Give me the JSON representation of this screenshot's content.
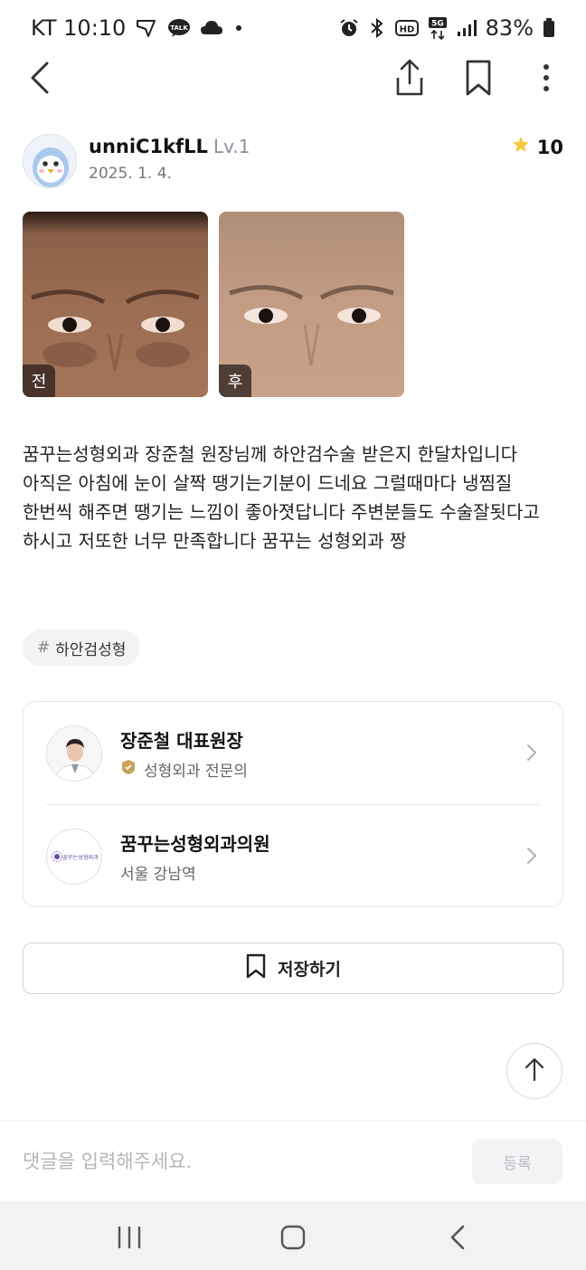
{
  "status_bar": {
    "carrier_time": "KT 10:10",
    "battery": "83%",
    "icons": [
      "navigation-icon",
      "talk-icon",
      "cloud-icon",
      "dot-icon",
      "alarm-icon",
      "bluetooth-icon",
      "hd-icon",
      "5g-icon",
      "signal-icon",
      "battery-icon"
    ],
    "talk_badge": "TALK",
    "hd_label": "HD",
    "network_label": "5G"
  },
  "app_bar": {
    "icons": [
      "back-arrow-icon",
      "share-icon",
      "bookmark-icon",
      "more-vertical-icon"
    ]
  },
  "author": {
    "name": "unniC1kfLL",
    "level": "Lv.1",
    "date": "2025. 1. 4.",
    "score": "10",
    "score_icon": "star-icon",
    "star_color": "#f5c93b"
  },
  "photos": [
    {
      "tag": "전",
      "kind": "before"
    },
    {
      "tag": "후",
      "kind": "after"
    }
  ],
  "review": {
    "text": "꿈꾸는성형외과 장준철 원장님께 하안검수술 받은지 한달차입니다\n아직은 아침에 눈이 살짝 땡기는기분이 드네요 그럴때마다 냉찜질\n한번씩 해주면 땡기는 느낌이 좋아졋답니다 주변분들도 수술잘됫다고\n하시고 저또한 너무 만족합니다 꿈꾸는 성형외과 짱"
  },
  "hashtag": {
    "symbol": "#",
    "label": "하안검성형"
  },
  "doctor": {
    "name": "장준철 대표원장",
    "specialty": "성형외과 전문의",
    "badge_color": "#c9a15c"
  },
  "clinic": {
    "name": "꿈꾸는성형외과의원",
    "location": "서울 강남역",
    "logo_text": "꿈꾸는성형외과",
    "logo_color": "#6a4aa5"
  },
  "save": {
    "label": "저장하기"
  },
  "comment": {
    "placeholder": "댓글을 입력해주세요.",
    "submit_label": "등록"
  },
  "nav": {
    "icons": [
      "recent-apps-icon",
      "home-icon",
      "back-icon"
    ]
  }
}
